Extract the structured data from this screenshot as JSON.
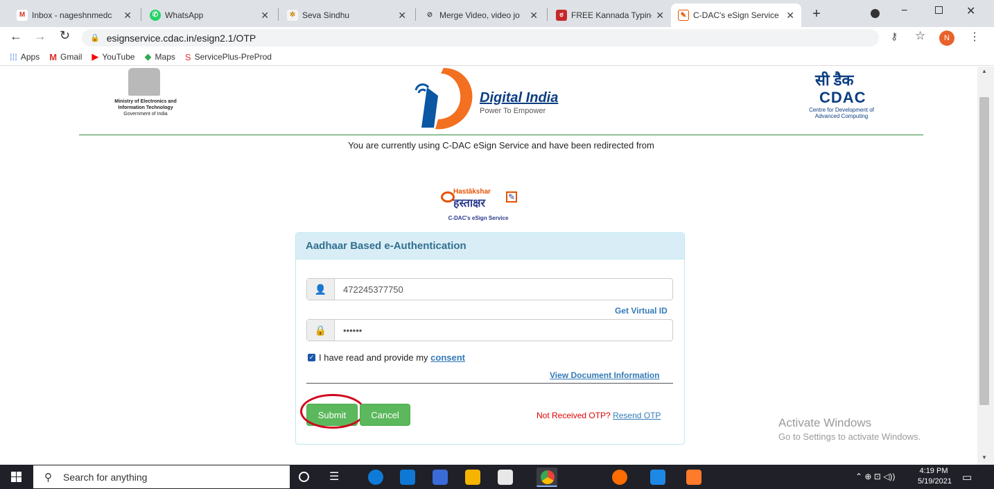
{
  "tabs": [
    {
      "label": "Inbox - nageshnmedc",
      "active": false
    },
    {
      "label": "WhatsApp",
      "active": false
    },
    {
      "label": "Seva Sindhu",
      "active": false
    },
    {
      "label": "Merge Video, video jo",
      "active": false
    },
    {
      "label": "FREE Kannada Typing |",
      "active": false
    },
    {
      "label": "C-DAC's eSign Service",
      "active": true
    }
  ],
  "address": "esignservice.cdac.in/esign2.1/OTP",
  "bookmarks": [
    "Apps",
    "Gmail",
    "YouTube",
    "Maps",
    "ServicePlus-PreProd"
  ],
  "profile_initial": "N",
  "header": {
    "meity_line1": "Ministry of Electronics and",
    "meity_line2": "Information Technology",
    "meity_line3": "Government of India",
    "di_title": "Digital India",
    "di_tagline": "Power To Empower",
    "cdac_hindi": "सी डैक",
    "cdac_logo": "CDAC",
    "cdac_line1": "Centre for Development of",
    "cdac_line2": "Advanced Computing"
  },
  "redirect_text": "You are currently using C-DAC eSign Service and have been redirected from",
  "hastakshar": {
    "latin": "Hastākshar",
    "devanagari": "हस्ताक्षर",
    "caption": "C-DAC's eSign Service"
  },
  "form": {
    "heading": "Aadhaar Based e-Authentication",
    "aadhaar_value": "472245377750",
    "get_virtual_id": "Get Virtual ID",
    "otp_value": "••••••",
    "consent_prefix": "I have read and provide my",
    "consent_link": "consent",
    "view_doc": "View Document Information",
    "submit": "Submit",
    "cancel": "Cancel",
    "not_received": "Not Received OTP?",
    "resend": "Resend OTP"
  },
  "activate": {
    "title": "Activate Windows",
    "subtitle": "Go to Settings to activate Windows."
  },
  "taskbar": {
    "search_placeholder": "Search for anything",
    "time": "4:19 PM",
    "date": "5/19/2021"
  },
  "colors": {
    "accent": "#5cb85c",
    "panel_head": "#d9edf7",
    "link": "#337ab7",
    "error": "#e00000",
    "tabstrip": "#dee1e6"
  }
}
